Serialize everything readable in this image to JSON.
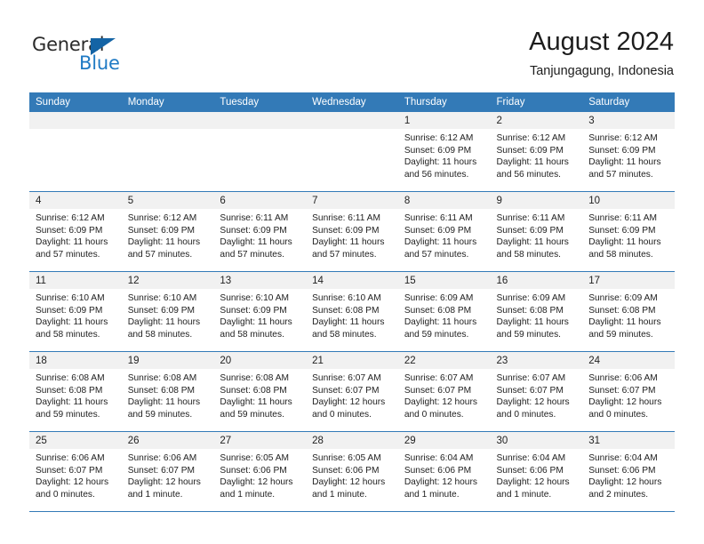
{
  "brand": {
    "name_top": "General",
    "name_bottom": "Blue",
    "triangle_color": "#1464a5",
    "blue_color": "#1f7ac4"
  },
  "header": {
    "title": "August 2024",
    "subtitle": "Tanjungagung, Indonesia"
  },
  "theme": {
    "header_blue": "#337ab7",
    "day_band_gray": "#f1f1f1",
    "text": "#222222"
  },
  "weekdays": [
    "Sunday",
    "Monday",
    "Tuesday",
    "Wednesday",
    "Thursday",
    "Friday",
    "Saturday"
  ],
  "weeks": [
    [
      {
        "day": "",
        "sunrise": "",
        "sunset": "",
        "daylight_a": "",
        "daylight_b": "",
        "empty": true
      },
      {
        "day": "",
        "sunrise": "",
        "sunset": "",
        "daylight_a": "",
        "daylight_b": "",
        "empty": true
      },
      {
        "day": "",
        "sunrise": "",
        "sunset": "",
        "daylight_a": "",
        "daylight_b": "",
        "empty": true
      },
      {
        "day": "",
        "sunrise": "",
        "sunset": "",
        "daylight_a": "",
        "daylight_b": "",
        "empty": true
      },
      {
        "day": "1",
        "sunrise": "Sunrise: 6:12 AM",
        "sunset": "Sunset: 6:09 PM",
        "daylight_a": "Daylight: 11 hours",
        "daylight_b": "and 56 minutes."
      },
      {
        "day": "2",
        "sunrise": "Sunrise: 6:12 AM",
        "sunset": "Sunset: 6:09 PM",
        "daylight_a": "Daylight: 11 hours",
        "daylight_b": "and 56 minutes."
      },
      {
        "day": "3",
        "sunrise": "Sunrise: 6:12 AM",
        "sunset": "Sunset: 6:09 PM",
        "daylight_a": "Daylight: 11 hours",
        "daylight_b": "and 57 minutes."
      }
    ],
    [
      {
        "day": "4",
        "sunrise": "Sunrise: 6:12 AM",
        "sunset": "Sunset: 6:09 PM",
        "daylight_a": "Daylight: 11 hours",
        "daylight_b": "and 57 minutes."
      },
      {
        "day": "5",
        "sunrise": "Sunrise: 6:12 AM",
        "sunset": "Sunset: 6:09 PM",
        "daylight_a": "Daylight: 11 hours",
        "daylight_b": "and 57 minutes."
      },
      {
        "day": "6",
        "sunrise": "Sunrise: 6:11 AM",
        "sunset": "Sunset: 6:09 PM",
        "daylight_a": "Daylight: 11 hours",
        "daylight_b": "and 57 minutes."
      },
      {
        "day": "7",
        "sunrise": "Sunrise: 6:11 AM",
        "sunset": "Sunset: 6:09 PM",
        "daylight_a": "Daylight: 11 hours",
        "daylight_b": "and 57 minutes."
      },
      {
        "day": "8",
        "sunrise": "Sunrise: 6:11 AM",
        "sunset": "Sunset: 6:09 PM",
        "daylight_a": "Daylight: 11 hours",
        "daylight_b": "and 57 minutes."
      },
      {
        "day": "9",
        "sunrise": "Sunrise: 6:11 AM",
        "sunset": "Sunset: 6:09 PM",
        "daylight_a": "Daylight: 11 hours",
        "daylight_b": "and 58 minutes."
      },
      {
        "day": "10",
        "sunrise": "Sunrise: 6:11 AM",
        "sunset": "Sunset: 6:09 PM",
        "daylight_a": "Daylight: 11 hours",
        "daylight_b": "and 58 minutes."
      }
    ],
    [
      {
        "day": "11",
        "sunrise": "Sunrise: 6:10 AM",
        "sunset": "Sunset: 6:09 PM",
        "daylight_a": "Daylight: 11 hours",
        "daylight_b": "and 58 minutes."
      },
      {
        "day": "12",
        "sunrise": "Sunrise: 6:10 AM",
        "sunset": "Sunset: 6:09 PM",
        "daylight_a": "Daylight: 11 hours",
        "daylight_b": "and 58 minutes."
      },
      {
        "day": "13",
        "sunrise": "Sunrise: 6:10 AM",
        "sunset": "Sunset: 6:09 PM",
        "daylight_a": "Daylight: 11 hours",
        "daylight_b": "and 58 minutes."
      },
      {
        "day": "14",
        "sunrise": "Sunrise: 6:10 AM",
        "sunset": "Sunset: 6:08 PM",
        "daylight_a": "Daylight: 11 hours",
        "daylight_b": "and 58 minutes."
      },
      {
        "day": "15",
        "sunrise": "Sunrise: 6:09 AM",
        "sunset": "Sunset: 6:08 PM",
        "daylight_a": "Daylight: 11 hours",
        "daylight_b": "and 59 minutes."
      },
      {
        "day": "16",
        "sunrise": "Sunrise: 6:09 AM",
        "sunset": "Sunset: 6:08 PM",
        "daylight_a": "Daylight: 11 hours",
        "daylight_b": "and 59 minutes."
      },
      {
        "day": "17",
        "sunrise": "Sunrise: 6:09 AM",
        "sunset": "Sunset: 6:08 PM",
        "daylight_a": "Daylight: 11 hours",
        "daylight_b": "and 59 minutes."
      }
    ],
    [
      {
        "day": "18",
        "sunrise": "Sunrise: 6:08 AM",
        "sunset": "Sunset: 6:08 PM",
        "daylight_a": "Daylight: 11 hours",
        "daylight_b": "and 59 minutes."
      },
      {
        "day": "19",
        "sunrise": "Sunrise: 6:08 AM",
        "sunset": "Sunset: 6:08 PM",
        "daylight_a": "Daylight: 11 hours",
        "daylight_b": "and 59 minutes."
      },
      {
        "day": "20",
        "sunrise": "Sunrise: 6:08 AM",
        "sunset": "Sunset: 6:08 PM",
        "daylight_a": "Daylight: 11 hours",
        "daylight_b": "and 59 minutes."
      },
      {
        "day": "21",
        "sunrise": "Sunrise: 6:07 AM",
        "sunset": "Sunset: 6:07 PM",
        "daylight_a": "Daylight: 12 hours",
        "daylight_b": "and 0 minutes."
      },
      {
        "day": "22",
        "sunrise": "Sunrise: 6:07 AM",
        "sunset": "Sunset: 6:07 PM",
        "daylight_a": "Daylight: 12 hours",
        "daylight_b": "and 0 minutes."
      },
      {
        "day": "23",
        "sunrise": "Sunrise: 6:07 AM",
        "sunset": "Sunset: 6:07 PM",
        "daylight_a": "Daylight: 12 hours",
        "daylight_b": "and 0 minutes."
      },
      {
        "day": "24",
        "sunrise": "Sunrise: 6:06 AM",
        "sunset": "Sunset: 6:07 PM",
        "daylight_a": "Daylight: 12 hours",
        "daylight_b": "and 0 minutes."
      }
    ],
    [
      {
        "day": "25",
        "sunrise": "Sunrise: 6:06 AM",
        "sunset": "Sunset: 6:07 PM",
        "daylight_a": "Daylight: 12 hours",
        "daylight_b": "and 0 minutes."
      },
      {
        "day": "26",
        "sunrise": "Sunrise: 6:06 AM",
        "sunset": "Sunset: 6:07 PM",
        "daylight_a": "Daylight: 12 hours",
        "daylight_b": "and 1 minute."
      },
      {
        "day": "27",
        "sunrise": "Sunrise: 6:05 AM",
        "sunset": "Sunset: 6:06 PM",
        "daylight_a": "Daylight: 12 hours",
        "daylight_b": "and 1 minute."
      },
      {
        "day": "28",
        "sunrise": "Sunrise: 6:05 AM",
        "sunset": "Sunset: 6:06 PM",
        "daylight_a": "Daylight: 12 hours",
        "daylight_b": "and 1 minute."
      },
      {
        "day": "29",
        "sunrise": "Sunrise: 6:04 AM",
        "sunset": "Sunset: 6:06 PM",
        "daylight_a": "Daylight: 12 hours",
        "daylight_b": "and 1 minute."
      },
      {
        "day": "30",
        "sunrise": "Sunrise: 6:04 AM",
        "sunset": "Sunset: 6:06 PM",
        "daylight_a": "Daylight: 12 hours",
        "daylight_b": "and 1 minute."
      },
      {
        "day": "31",
        "sunrise": "Sunrise: 6:04 AM",
        "sunset": "Sunset: 6:06 PM",
        "daylight_a": "Daylight: 12 hours",
        "daylight_b": "and 2 minutes."
      }
    ]
  ]
}
